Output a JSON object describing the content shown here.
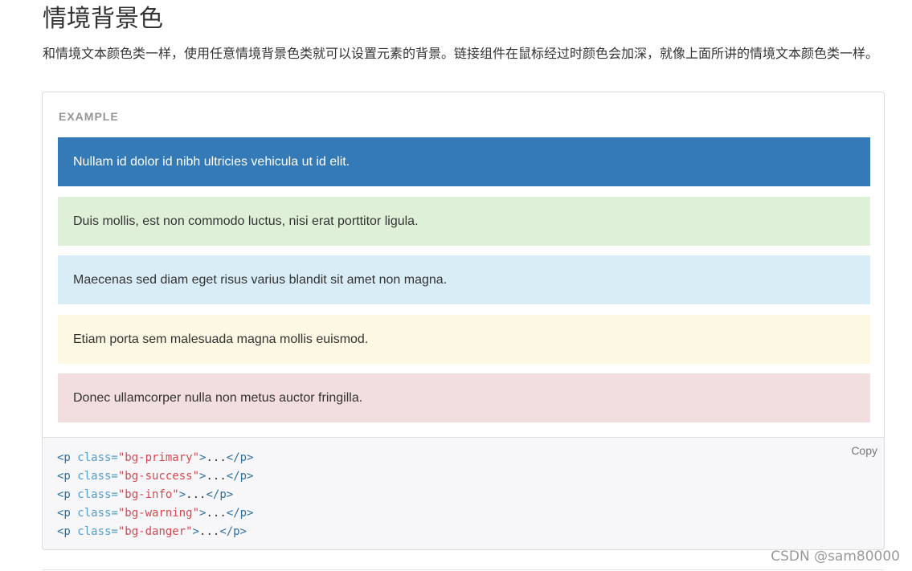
{
  "heading": "情境背景色",
  "intro": "和情境文本颜色类一样，使用任意情境背景色类就可以设置元素的背景。链接组件在鼠标经过时颜色会加深，就像上面所讲的情境文本颜色类一样。",
  "example": {
    "label": "EXAMPLE",
    "rows": [
      {
        "text": "Nullam id dolor id nibh ultricies vehicula ut id elit.",
        "color": "#337ab7"
      },
      {
        "text": "Duis mollis, est non commodo luctus, nisi erat porttitor ligula.",
        "color": "#dff0d8"
      },
      {
        "text": "Maecenas sed diam eget risus varius blandit sit amet non magna.",
        "color": "#d9edf7"
      },
      {
        "text": "Etiam porta sem malesuada magna mollis euismod.",
        "color": "#fcf8e3"
      },
      {
        "text": "Donec ullamcorper nulla non metus auctor fringilla.",
        "color": "#f2dede"
      }
    ]
  },
  "code": {
    "copy_label": "Copy",
    "lines": [
      {
        "open": "<p",
        "attr": " class=",
        "value": "\"bg-primary\"",
        "rest_tag": ">",
        "ellipsis": "...",
        "close": "</p>"
      },
      {
        "open": "<p",
        "attr": " class=",
        "value": "\"bg-success\"",
        "rest_tag": ">",
        "ellipsis": "...",
        "close": "</p>"
      },
      {
        "open": "<p",
        "attr": " class=",
        "value": "\"bg-info\"",
        "rest_tag": ">",
        "ellipsis": "...",
        "close": "</p>"
      },
      {
        "open": "<p",
        "attr": " class=",
        "value": "\"bg-warning\"",
        "rest_tag": ">",
        "ellipsis": "...",
        "close": "</p>"
      },
      {
        "open": "<p",
        "attr": " class=",
        "value": "\"bg-danger\"",
        "rest_tag": ">",
        "ellipsis": "...",
        "close": "</p>"
      }
    ]
  },
  "watermark": "CSDN @sam80000"
}
